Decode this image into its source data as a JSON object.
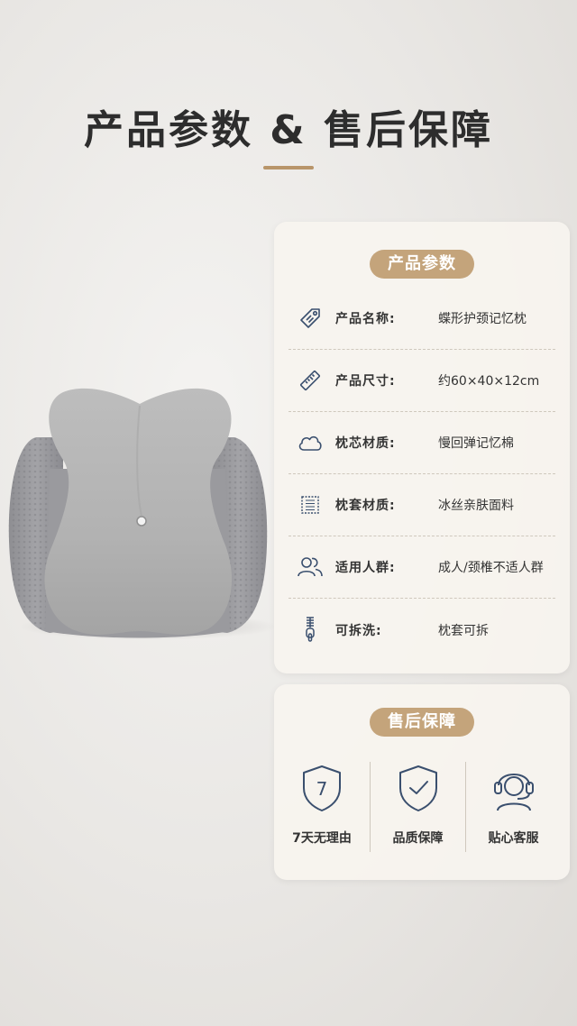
{
  "header": {
    "title": "产品参数 & 售后保障"
  },
  "params": {
    "heading": "产品参数",
    "rows": [
      {
        "icon": "tag-icon",
        "label": "产品名称:",
        "value": "蝶形护颈记忆枕"
      },
      {
        "icon": "ruler-icon",
        "label": "产品尺寸:",
        "value": "约60×40×12cm"
      },
      {
        "icon": "cloud-icon",
        "label": "枕芯材质:",
        "value": "慢回弹记忆棉"
      },
      {
        "icon": "fabric-icon",
        "label": "枕套材质:",
        "value": "冰丝亲肤面料"
      },
      {
        "icon": "users-icon",
        "label": "适用人群:",
        "value": "成人/颈椎不适人群"
      },
      {
        "icon": "zipper-icon",
        "label": "可拆洗:",
        "value": "枕套可拆"
      }
    ]
  },
  "service": {
    "heading": "售后保障",
    "items": [
      {
        "icon": "seven-day-shield-icon",
        "label": "7天无理由",
        "badge_text": "7"
      },
      {
        "icon": "check-shield-icon",
        "label": "品质保障"
      },
      {
        "icon": "headset-agent-icon",
        "label": "贴心客服"
      }
    ]
  },
  "colors": {
    "accent": "#c4a47b",
    "icon": "#3a4f6e",
    "title": "#2d2d2d"
  }
}
